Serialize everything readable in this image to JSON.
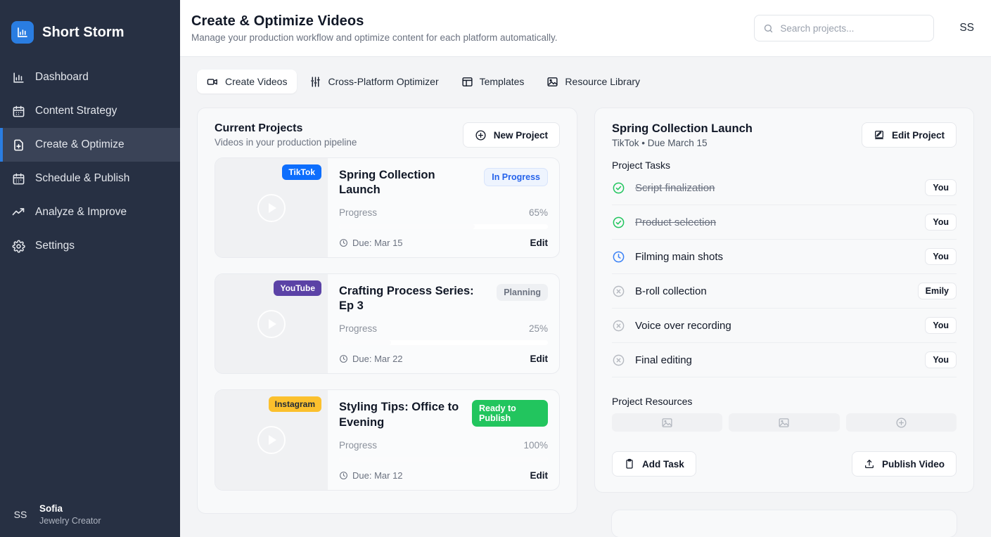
{
  "brand": {
    "name": "Short Storm",
    "logo_icon": "bar-chart-icon",
    "accent": "#2a7de1"
  },
  "sidebar": {
    "items": [
      {
        "label": "Dashboard",
        "icon": "bar-chart-icon",
        "active": false
      },
      {
        "label": "Content Strategy",
        "icon": "calendar-icon",
        "active": false
      },
      {
        "label": "Create & Optimize",
        "icon": "file-plus-icon",
        "active": true
      },
      {
        "label": "Schedule & Publish",
        "icon": "calendar-icon",
        "active": false
      },
      {
        "label": "Analyze & Improve",
        "icon": "trending-up-icon",
        "active": false
      },
      {
        "label": "Settings",
        "icon": "gear-icon",
        "active": false
      }
    ],
    "user": {
      "initials": "SS",
      "name": "Sofia",
      "role": "Jewelry Creator"
    }
  },
  "header": {
    "title": "Create & Optimize Videos",
    "subtitle": "Manage your production workflow and optimize content for each platform automatically.",
    "search": {
      "placeholder": "Search projects...",
      "value": "",
      "icon": "search-icon"
    },
    "avatar_initials": "SS"
  },
  "tabs": [
    {
      "label": "Create Videos",
      "icon": "video-camera-icon",
      "active": true
    },
    {
      "label": "Cross-Platform Optimizer",
      "icon": "sliders-icon",
      "active": false
    },
    {
      "label": "Templates",
      "icon": "layout-icon",
      "active": false
    },
    {
      "label": "Resource Library",
      "icon": "image-icon",
      "active": false
    }
  ],
  "projects_panel": {
    "title": "Current Projects",
    "subtitle": "Videos in your production pipeline",
    "new_project_label": "New Project",
    "new_project_icon": "plus-circle-icon",
    "progress_label": "Progress",
    "due_prefix": "Due:",
    "edit_label": "Edit",
    "items": [
      {
        "platform": "TikTok",
        "platform_color": "#0d6efd",
        "name": "Spring Collection Launch",
        "status": "In Progress",
        "status_style": "st-progress",
        "progress": 65,
        "progress_text": "65%",
        "due": "Due: Mar 15"
      },
      {
        "platform": "YouTube",
        "platform_color": "#5b42a6",
        "name": "Crafting Process Series: Ep 3",
        "status": "Planning",
        "status_style": "st-planning",
        "progress": 25,
        "progress_text": "25%",
        "due": "Due: Mar 22"
      },
      {
        "platform": "Instagram",
        "platform_color": "#fbc02d",
        "name": "Styling Tips: Office to Evening",
        "status": "Ready to Publish",
        "status_style": "st-ready",
        "progress": 100,
        "progress_text": "100%",
        "due": "Due: Mar 12"
      }
    ]
  },
  "detail_panel": {
    "title": "Spring Collection Launch",
    "subtitle": "TikTok • Due March 15",
    "edit_project_label": "Edit Project",
    "edit_project_icon": "pencil-square-icon",
    "tasks_label": "Project Tasks",
    "tasks": [
      {
        "name": "Script finalization",
        "state": "done",
        "assignee": "You",
        "icon": "check-circle-icon"
      },
      {
        "name": "Product selection",
        "state": "done",
        "assignee": "You",
        "icon": "check-circle-icon"
      },
      {
        "name": "Filming main shots",
        "state": "in-progress",
        "assignee": "You",
        "icon": "clock-icon"
      },
      {
        "name": "B-roll collection",
        "state": "pending",
        "assignee": "Emily",
        "icon": "x-circle-icon"
      },
      {
        "name": "Voice over recording",
        "state": "pending",
        "assignee": "You",
        "icon": "x-circle-icon"
      },
      {
        "name": "Final editing",
        "state": "pending",
        "assignee": "You",
        "icon": "x-circle-icon"
      }
    ],
    "resources_label": "Project Resources",
    "resources": [
      {
        "icon": "image-icon"
      },
      {
        "icon": "image-icon"
      },
      {
        "icon": "plus-circle-icon"
      }
    ],
    "add_task_label": "Add Task",
    "add_task_icon": "clipboard-icon",
    "publish_label": "Publish Video",
    "publish_icon": "upload-icon"
  }
}
